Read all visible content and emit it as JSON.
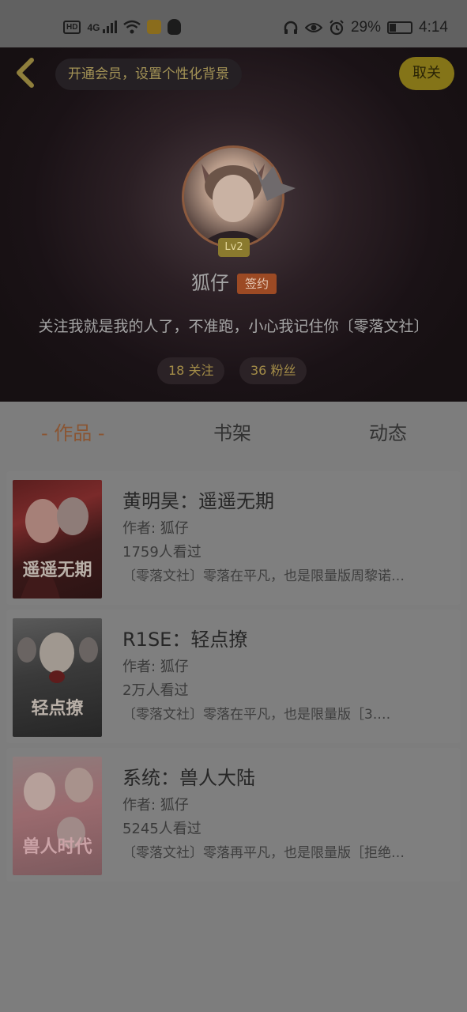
{
  "status_bar": {
    "network": "4G",
    "hd": "HD",
    "battery_percent": 29,
    "battery_text": "29%",
    "time": "4:14"
  },
  "header": {
    "member_tip": "开通会员，设置个性化背景",
    "unfollow_label": "取关"
  },
  "profile": {
    "level": "Lv2",
    "name": "狐仔",
    "badge": "签约",
    "bio": "关注我就是我的人了，不准跑，小心我记住你〔零落文社〕",
    "following": "18 关注",
    "fans": "36 粉丝"
  },
  "tabs": [
    {
      "label": "- 作品 -",
      "active": true
    },
    {
      "label": "书架",
      "active": false
    },
    {
      "label": "动态",
      "active": false
    }
  ],
  "books": [
    {
      "title": "黄明昊：遥遥无期",
      "author": "作者: 狐仔",
      "reads": "1759人看过",
      "desc": "〔零落文社〕零落在平凡，也是限量版周黎诺…",
      "cover_text": "遥遥无期"
    },
    {
      "title": "R1SE：轻点撩",
      "author": "作者: 狐仔",
      "reads": "2万人看过",
      "desc": "〔零落文社〕零落在平凡，也是限量版［3.…",
      "cover_text": "轻点撩"
    },
    {
      "title": "系统：兽人大陆",
      "author": "作者: 狐仔",
      "reads": "5245人看过",
      "desc": "〔零落文社〕零落再平凡，也是限量版［拒绝…",
      "cover_text": "兽人时代"
    }
  ],
  "colors": {
    "accent": "#8a5532",
    "unfollow_bg": "#847418",
    "signed_badge_bg": "#9c4a24",
    "list_bg": "#7d7d7d"
  }
}
